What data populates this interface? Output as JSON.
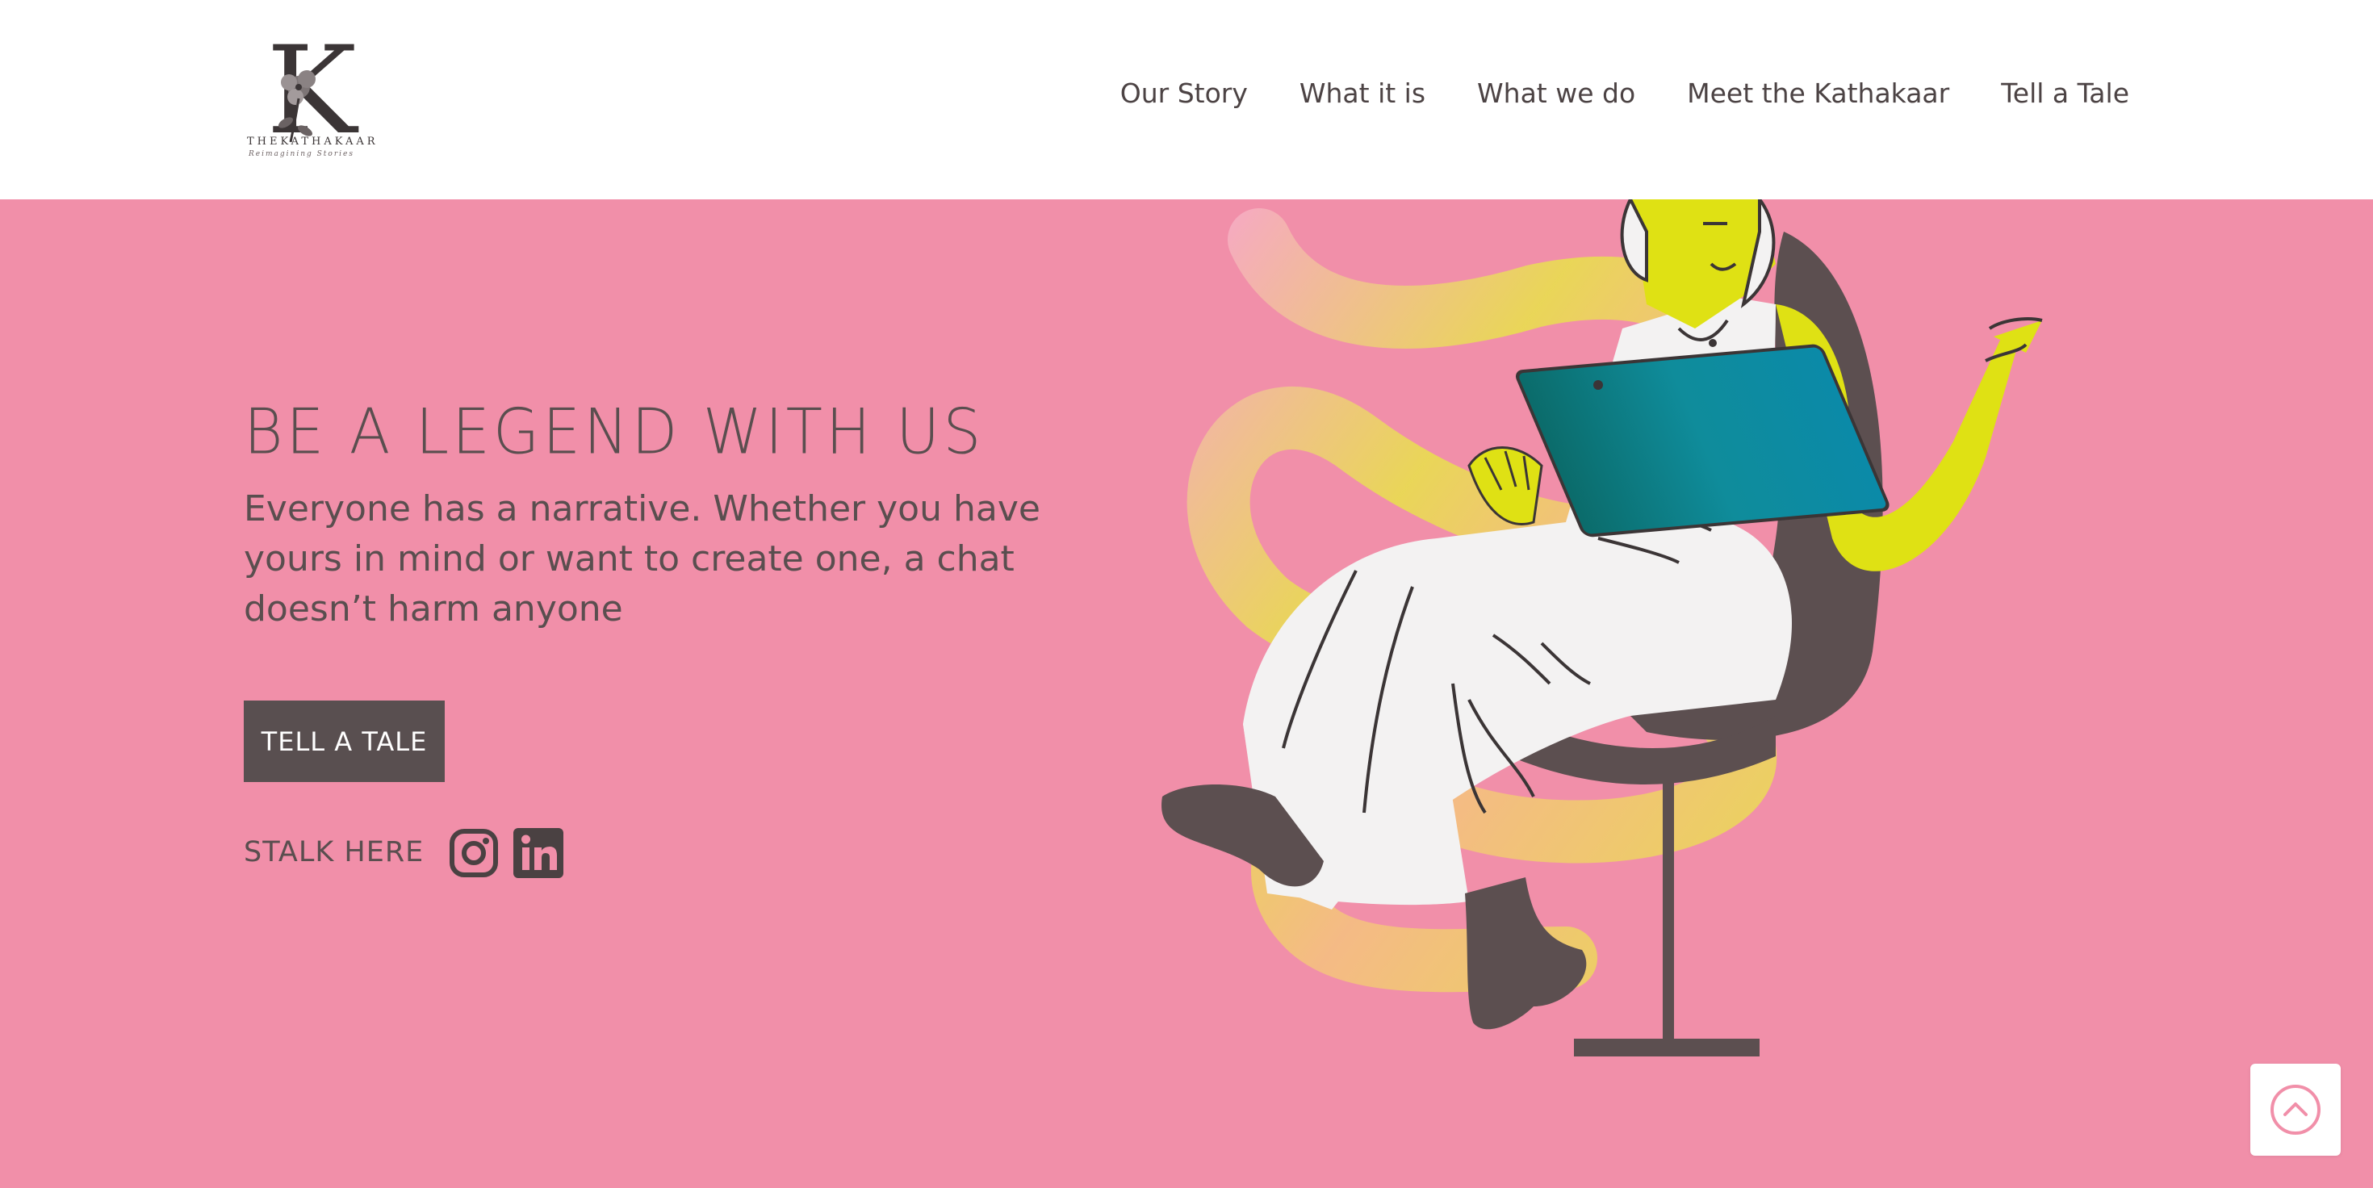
{
  "brand": {
    "logo_letter": "K",
    "name": "THEKATHAKAAR",
    "tagline": "Reimagining Stories"
  },
  "nav": {
    "items": [
      {
        "label": "Our Story"
      },
      {
        "label": "What it is"
      },
      {
        "label": "What we do"
      },
      {
        "label": "Meet the Kathakaar"
      },
      {
        "label": "Tell a Tale"
      }
    ]
  },
  "hero": {
    "title": "BE A LEGEND WITH US",
    "subtitle": "Everyone has a narrative. Whether you have yours in mind or want to create one, a chat doesn’t harm anyone",
    "cta_label": "TELL A TALE",
    "stalk_label": "STALK HERE"
  },
  "social": [
    {
      "icon": "instagram-icon"
    },
    {
      "icon": "linkedin-icon"
    }
  ],
  "scroll_top": {
    "icon": "chevron-up-circle-icon"
  },
  "colors": {
    "background": "#f18fa9",
    "header": "#ffffff",
    "text": "#5a4e4f",
    "button": "#594f50",
    "accent_yellow": "#dfe114",
    "accent_teal": "#0f8c9b"
  }
}
